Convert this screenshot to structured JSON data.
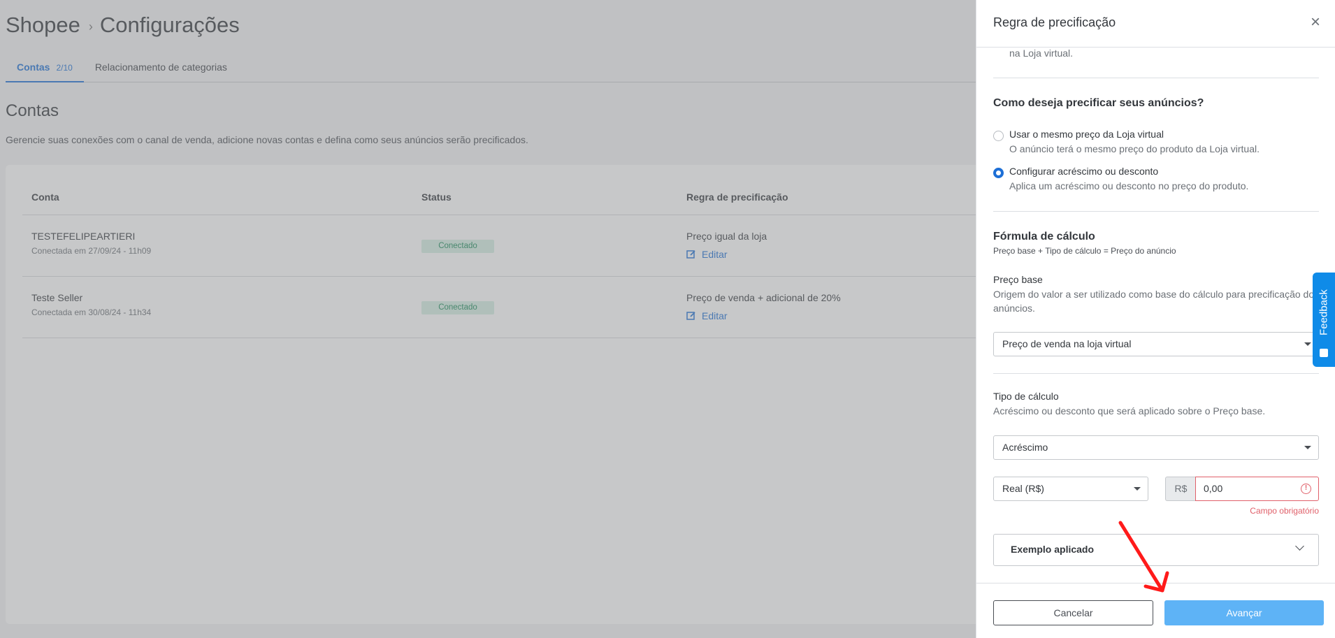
{
  "breadcrumb": {
    "root": "Shopee",
    "separator": "›",
    "current": "Configurações"
  },
  "tabs": [
    {
      "label": "Contas",
      "count": "2/10",
      "active": true
    },
    {
      "label": "Relacionamento de categorias",
      "active": false
    }
  ],
  "accounts_section": {
    "title": "Contas",
    "description": "Gerencie suas conexões com o canal de venda, adicione novas contas e defina como seus anúncios serão precificados."
  },
  "table": {
    "headers": {
      "account": "Conta",
      "status": "Status",
      "rule": "Regra de precificação"
    },
    "rows": [
      {
        "name": "TESTEFELIPEARTIERI",
        "since": "Conectada em 27/09/24 - 11h09",
        "status": "Conectado",
        "rule": "Preço igual da loja",
        "edit": "Editar"
      },
      {
        "name": "Teste Seller",
        "since": "Conectada em 30/08/24 - 11h34",
        "status": "Conectado",
        "rule": "Preço de venda + adicional de 20%",
        "edit": "Editar"
      }
    ]
  },
  "drawer": {
    "title": "Regra de precificação",
    "close": "×",
    "top_cut_text": "na Loja virtual.",
    "question": "Como deseja precificar seus anúncios?",
    "options": [
      {
        "label": "Usar o mesmo preço da Loja virtual",
        "sub": "O anúncio terá o mesmo preço do produto da Loja virtual.",
        "checked": false
      },
      {
        "label": "Configurar acréscimo ou desconto",
        "sub": "Aplica um acréscimo ou desconto no preço do produto.",
        "checked": true
      }
    ],
    "formula": {
      "title": "Fórmula de cálculo",
      "part1": "Preço base",
      "plus": "+",
      "part2": "Tipo de cálculo",
      "equals": "=",
      "part3": "Preço do anúncio"
    },
    "base_price": {
      "label": "Preço base",
      "help": "Origem do valor a ser utilizado como base do cálculo para precificação dos anúncios.",
      "value": "Preço de venda na loja virtual"
    },
    "calc_type": {
      "label": "Tipo de cálculo",
      "help": "Acréscimo ou desconto que será aplicado sobre o Preço base.",
      "value": "Acréscimo",
      "unit": "Real (R$)",
      "prefix": "R$",
      "amount": "0,00",
      "error": "Campo obrigatório"
    },
    "example": {
      "label": "Exemplo aplicado"
    },
    "footer": {
      "cancel": "Cancelar",
      "next": "Avançar"
    }
  },
  "feedback": {
    "label": "Feedback"
  },
  "colors": {
    "accent": "#1d6fd6",
    "primary_button": "#5eb3f6",
    "error": "#e0606a",
    "success_badge": "#d5efe4",
    "feedback": "#0f8be8",
    "annotation_arrow": "#ff1a1a"
  }
}
